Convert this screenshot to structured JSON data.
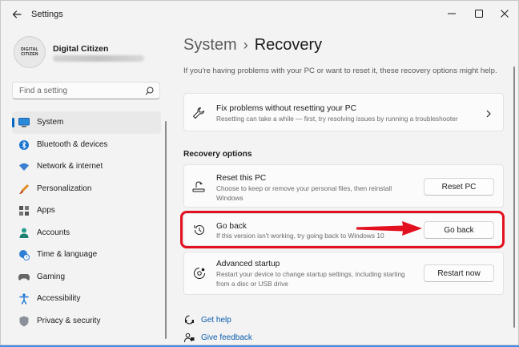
{
  "window": {
    "title": "Settings",
    "controls": [
      "minimize-icon",
      "maximize-icon",
      "close-icon"
    ]
  },
  "profile": {
    "avatar_text": [
      "DIGITAL",
      "CITIZEN"
    ],
    "name": "Digital Citizen"
  },
  "search": {
    "placeholder": "Find a setting",
    "icon": "search-icon"
  },
  "sidebar": {
    "items": [
      {
        "label": "System",
        "icon": "monitor-icon",
        "selected": true
      },
      {
        "label": "Bluetooth & devices",
        "icon": "bluetooth-icon"
      },
      {
        "label": "Network & internet",
        "icon": "wifi-icon"
      },
      {
        "label": "Personalization",
        "icon": "brush-icon"
      },
      {
        "label": "Apps",
        "icon": "apps-icon"
      },
      {
        "label": "Accounts",
        "icon": "person-icon"
      },
      {
        "label": "Time & language",
        "icon": "globe-clock-icon"
      },
      {
        "label": "Gaming",
        "icon": "gamepad-icon"
      },
      {
        "label": "Accessibility",
        "icon": "accessibility-icon"
      },
      {
        "label": "Privacy & security",
        "icon": "shield-icon"
      }
    ]
  },
  "breadcrumb": {
    "parent": "System",
    "separator": "›",
    "current": "Recovery"
  },
  "intro": "If you're having problems with your PC or want to reset it, these recovery options might help.",
  "fix_card": {
    "title": "Fix problems without resetting your PC",
    "description": "Resetting can take a while — first, try resolving issues by running a troubleshooter"
  },
  "recovery_options": {
    "heading": "Recovery options",
    "reset": {
      "title": "Reset this PC",
      "description": "Choose to keep or remove your personal files, then reinstall Windows",
      "button": "Reset PC"
    },
    "go_back": {
      "title": "Go back",
      "description": "If this version isn't working, try going back to Windows 10",
      "button": "Go back"
    },
    "advanced": {
      "title": "Advanced startup",
      "description": "Restart your device to change startup settings, including starting from a disc or USB drive",
      "button": "Restart now"
    }
  },
  "links": {
    "help": "Get help",
    "feedback": "Give feedback"
  },
  "colors": {
    "accent": "#0067c0",
    "highlight": "#e3101f",
    "link": "#0b5cad"
  }
}
